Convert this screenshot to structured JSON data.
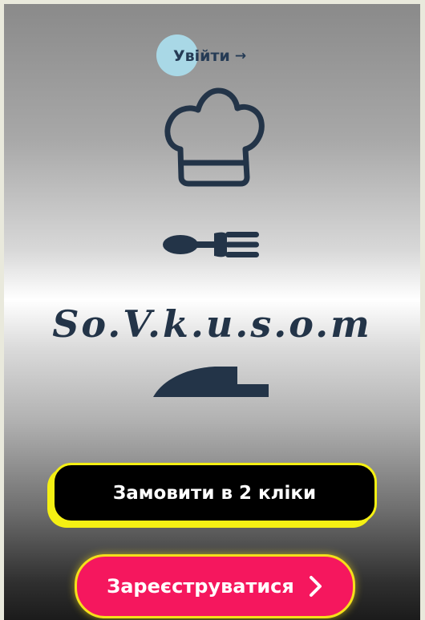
{
  "header": {
    "login_label": "Увійти",
    "login_arrow": "→"
  },
  "brand": {
    "name": "So.V.k.u.s.o.m"
  },
  "icons": {
    "chef_hat": "chef-hat-icon",
    "fork": "fork-icon",
    "knife": "knife-icon",
    "chevron": "chevron-right-icon"
  },
  "actions": {
    "order_label": "Замовити в 2 кліки",
    "register_label": "Зареєструватися"
  },
  "colors": {
    "accent_dark": "#233448",
    "yellow": "#f5f013",
    "pink": "#f5175e",
    "login_circle": "#a9d8e6"
  }
}
